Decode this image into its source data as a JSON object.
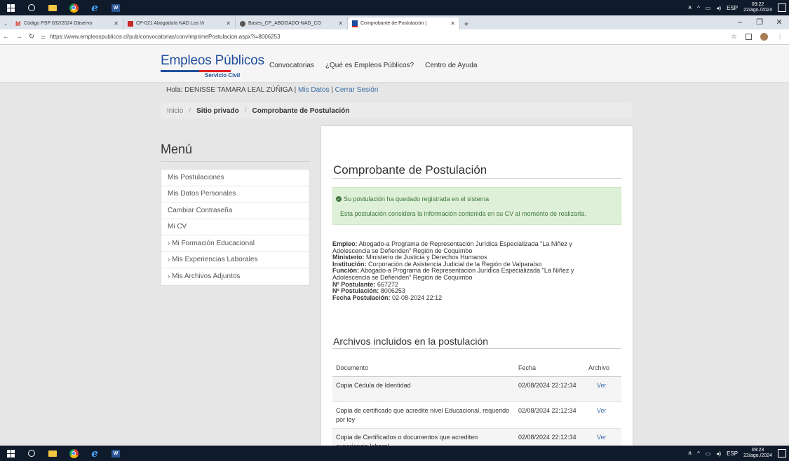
{
  "taskbar": {
    "lang": "ESP",
    "top_time": "09:22",
    "top_date": "22/ago./2024",
    "bottom_time": "09:23",
    "bottom_date": "22/ago./2024"
  },
  "tabs": [
    {
      "title": "Código PSP 032/2024 Observo",
      "color": "#d93025",
      "active": false
    },
    {
      "title": "CP-021 Abogado/a NAD Los Vi",
      "color": "#c62828",
      "active": false
    },
    {
      "title": "Bases_CP_ABOGADO-NAD_CO",
      "color": "#555555",
      "active": false
    },
    {
      "title": "Comprobante de Postulación |",
      "color": "#1f4f9c",
      "active": true
    }
  ],
  "address": {
    "url": "https://www.empleospublicos.cl/pub/convocatorias/convImprimePostulacion.aspx?i=8006253"
  },
  "site": {
    "brand": "Empleos Públicos",
    "brand_sub": "Servicio Civil",
    "nav": [
      "Convocatorias",
      "¿Qué es Empleos Públicos?",
      "Centro de Ayuda"
    ],
    "greeting": "Hola: DENISSE TAMARA LEAL ZÚÑIGA |",
    "mis_datos": "Mis Datos",
    "pipe": "|",
    "cerrar": "Cerrar Sesión",
    "breadcrumb": [
      "Inicio",
      "Sitio privado",
      "Comprobante de Postulación"
    ]
  },
  "menu": {
    "title": "Menú",
    "items": [
      "Mis Postulaciones",
      "Mis Datos Personales",
      "Cambiar Contraseña",
      "Mi CV",
      "› Mi Formación Educacional",
      "› Mis Experiencias Laborales",
      "› Mis Archivos Adjuntos"
    ]
  },
  "main": {
    "title": "Comprobante de Postulación",
    "alert_line1": "Su postulación ha quedado registrada en el sistema",
    "alert_line2": "Esta postulación considera la información contenida en su CV al momento de realizarla.",
    "empleo_label": "Empleo:",
    "empleo": "Abogado-a Programa de Representación Jurídica Especializada \"La Niñez y Adolescencia se Defienden\" Región de Coquimbo",
    "ministerio_label": "Ministerio:",
    "ministerio": "Ministerio de Justicia y Derechos Humanos",
    "institucion_label": "Institución:",
    "institucion": "Corporación de Asistencia Judicial de la Región de Valparaíso",
    "funcion_label": "Función:",
    "funcion": "Abogado-a Programa de Representación Jurídica Especializada \"La Niñez y Adolescencia se Defienden\" Región de Coquimbo",
    "postulante_label": "Nº Postulante:",
    "postulante": "667272",
    "postulacion_label": "Nº Postulación:",
    "postulacion": "8006253",
    "fecha_label": "Fecha Postulación:",
    "fecha": "02-08-2024 22:12",
    "files_title": "Archivos incluidos en la postulación",
    "table_headers": [
      "Documento",
      "Fecha",
      "Archivo"
    ],
    "rows": [
      {
        "doc": "Copia Cédula de Identidad",
        "fecha": "02/08/2024 22:12:34",
        "link": "Ver"
      },
      {
        "doc": "Copia de certificado que acredite nivel Educacional, requerido por ley",
        "fecha": "02/08/2024 22:12:34",
        "link": "Ver"
      },
      {
        "doc": "Copia de Certificados o documentos que acrediten experiencia laboral",
        "fecha": "02/08/2024 22:12:34",
        "link": "Ver"
      }
    ]
  }
}
